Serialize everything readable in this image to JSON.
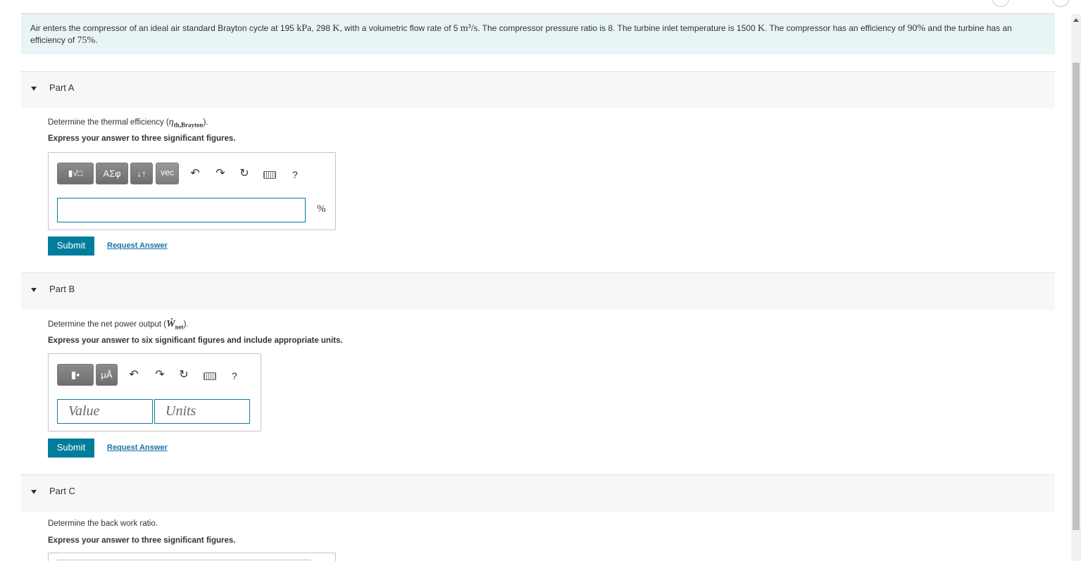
{
  "problem": {
    "text_1": "Air enters the compressor of an ideal air standard Brayton cycle at 195 ",
    "kpa": "kPa",
    "text_2": ", 298 ",
    "k1": "K",
    "text_3": ", with a volumetric flow rate of 5 ",
    "m3s": "m³/s",
    "text_4": ". The compressor pressure ratio is 8. The turbine inlet temperature is 1500 ",
    "k2": "K",
    "text_5": ". The compressor has an efficiency of ",
    "pct90": "90%",
    "text_6": " and the turbine has an efficiency of ",
    "pct75": "75%",
    "text_7": "."
  },
  "part_a": {
    "title": "Part A",
    "prompt_pre": "Determine the thermal efficiency (",
    "symbol": "η",
    "subscript": "th,Brayton",
    "prompt_post": ").",
    "instruction": "Express your answer to three significant figures.",
    "toolbar": {
      "templates": "▮√□",
      "greek": "ΑΣφ",
      "arrows": "↓↑",
      "vec": "vec",
      "undo": "↶",
      "redo": "↷",
      "reset": "↻",
      "help": "?"
    },
    "unit": "%",
    "submit_label": "Submit",
    "request_label": "Request Answer"
  },
  "part_b": {
    "title": "Part B",
    "prompt_pre": "Determine the net power output (",
    "symbol": "Ẇ",
    "subscript": "net",
    "prompt_post": ").",
    "instruction": "Express your answer to six significant figures and include appropriate units.",
    "toolbar": {
      "templates": "▮▪",
      "units": "μÅ",
      "undo": "↶",
      "redo": "↷",
      "reset": "↻",
      "help": "?"
    },
    "value_placeholder": "Value",
    "units_placeholder": "Units",
    "submit_label": "Submit",
    "request_label": "Request Answer"
  },
  "part_c": {
    "title": "Part C",
    "prompt": "Determine the back work ratio.",
    "instruction": "Express your answer to three significant figures."
  }
}
